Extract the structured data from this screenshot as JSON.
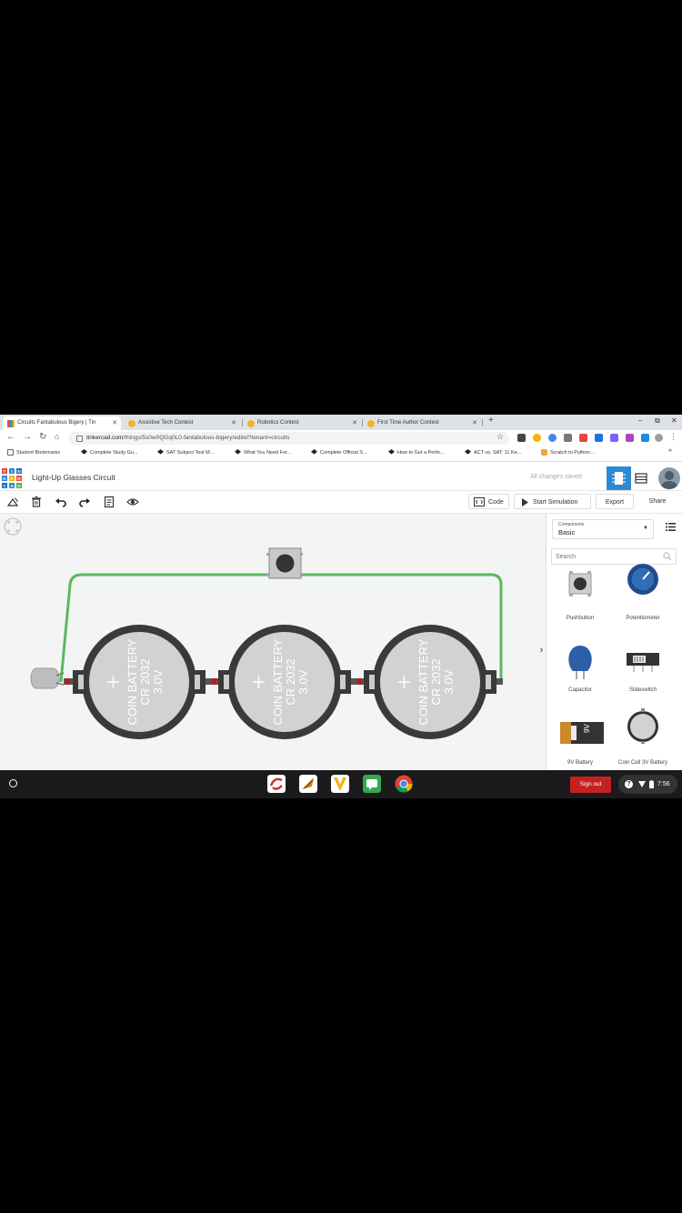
{
  "browser": {
    "tabs": [
      {
        "title": "Circuits Fantabulous Bigery | Tin",
        "active": true
      },
      {
        "title": "Assistive Tech Contest",
        "active": false
      },
      {
        "title": "Robotics Contest",
        "active": false
      },
      {
        "title": "First Time Author Contest",
        "active": false
      }
    ],
    "new_tab": "+",
    "url_host": "tinkercad.com",
    "url_path": "/things/5s0w0QGq0L0-fantabulous-bigery/editel?tenant=circuits",
    "bookmarks": [
      "Student Bookmarks",
      "Complete Study Gu...",
      "SAT Subject Test M...",
      "What You Need For...",
      "Complete Official S...",
      "How to Get a Perfe...",
      "ACT vs. SAT: 11 Ke...",
      "Scratch to Python:..."
    ],
    "bookmarks_overflow": "»"
  },
  "tinkercad": {
    "logo_letters": [
      "T",
      "I",
      "N",
      "K",
      "E",
      "R",
      "C",
      "A",
      "D"
    ],
    "design_title": "Light-Up Glasses Circuit",
    "save_status": "All changes saved",
    "toolbar": {
      "code": "Code",
      "start_simulation": "Start Simulation",
      "export": "Export",
      "share": "Share"
    },
    "batteries": [
      {
        "line1": "COIN BATTERY",
        "line2": "CR 2032",
        "line3": "3.0V"
      },
      {
        "line1": "COIN BATTERY",
        "line2": "CR 2032",
        "line3": "3.0V"
      },
      {
        "line1": "COIN BATTERY",
        "line2": "CR 2032",
        "line3": "3.0V"
      }
    ],
    "panel": {
      "components_label": "Components",
      "components_value": "Basic",
      "search_placeholder": "Search",
      "components": [
        {
          "name": "Pushbutton"
        },
        {
          "name": "Potentiometer"
        },
        {
          "name": "Capacitor"
        },
        {
          "name": "Slideswitch"
        },
        {
          "name": "9V Battery",
          "badge": "9V"
        },
        {
          "name": "Coin Cell 3V Battery"
        }
      ]
    },
    "colors": {
      "accent": "#2a8bd4",
      "wire": "#5cb85c",
      "battery_body": "#3a3a3a",
      "battery_face": "#d2d2d2"
    }
  },
  "shelf": {
    "sign_out": "Sign out",
    "time": "7:56"
  }
}
